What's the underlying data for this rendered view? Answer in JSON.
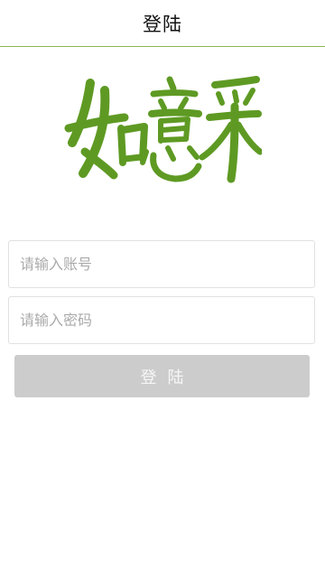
{
  "header": {
    "title": "登陆"
  },
  "logo": {
    "text": "如意采",
    "color": "#5e9a23"
  },
  "login_form": {
    "account_placeholder": "请输入账号",
    "account_value": "",
    "password_placeholder": "请输入密码",
    "password_value": "",
    "submit_label": "登陆"
  },
  "colors": {
    "header_border": "#8bb54d",
    "button_disabled": "#cccccc",
    "button_text": "#f6f6f6",
    "placeholder": "#aaaaaa"
  }
}
